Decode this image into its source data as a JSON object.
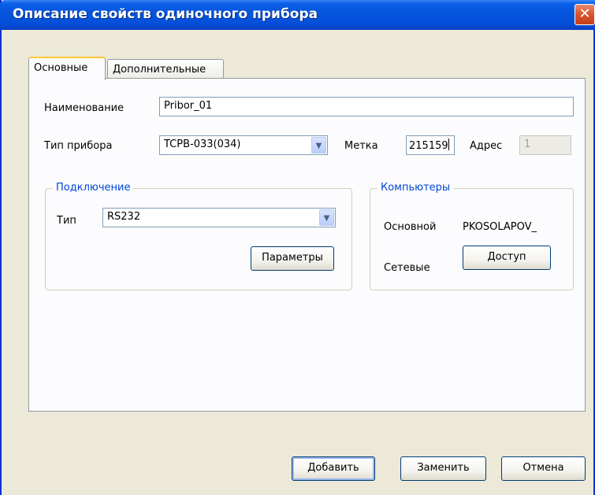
{
  "window": {
    "title": "Описание свойств одиночного прибора",
    "close_glyph": "✕"
  },
  "tabs": [
    {
      "label": "Основные",
      "active": true
    },
    {
      "label": "Дополнительные",
      "active": false
    }
  ],
  "main": {
    "name_label": "Наименование",
    "name_value": "Pribor_01",
    "device_type_label": "Тип прибора",
    "device_type_value": "TCPB-033(034)",
    "tag_label": "Метка",
    "tag_value": "215159",
    "address_label": "Адрес",
    "address_value": "1"
  },
  "connection": {
    "title": "Подключение",
    "type_label": "Тип",
    "type_value": "RS232",
    "params_button": "Параметры"
  },
  "computers": {
    "title": "Компьютеры",
    "primary_label": "Основной",
    "primary_value": "PKOSOLAPOV_",
    "network_label": "Сетевые",
    "access_button": "Доступ"
  },
  "buttons": {
    "add": "Добавить",
    "replace": "Заменить",
    "cancel": "Отмена"
  },
  "icons": {
    "dropdown": "chevron-down-icon",
    "close": "close-icon"
  },
  "colors": {
    "titlebar": "#0553db",
    "accent_group_title": "#0046d5",
    "dialog_bg": "#ece9d8"
  }
}
